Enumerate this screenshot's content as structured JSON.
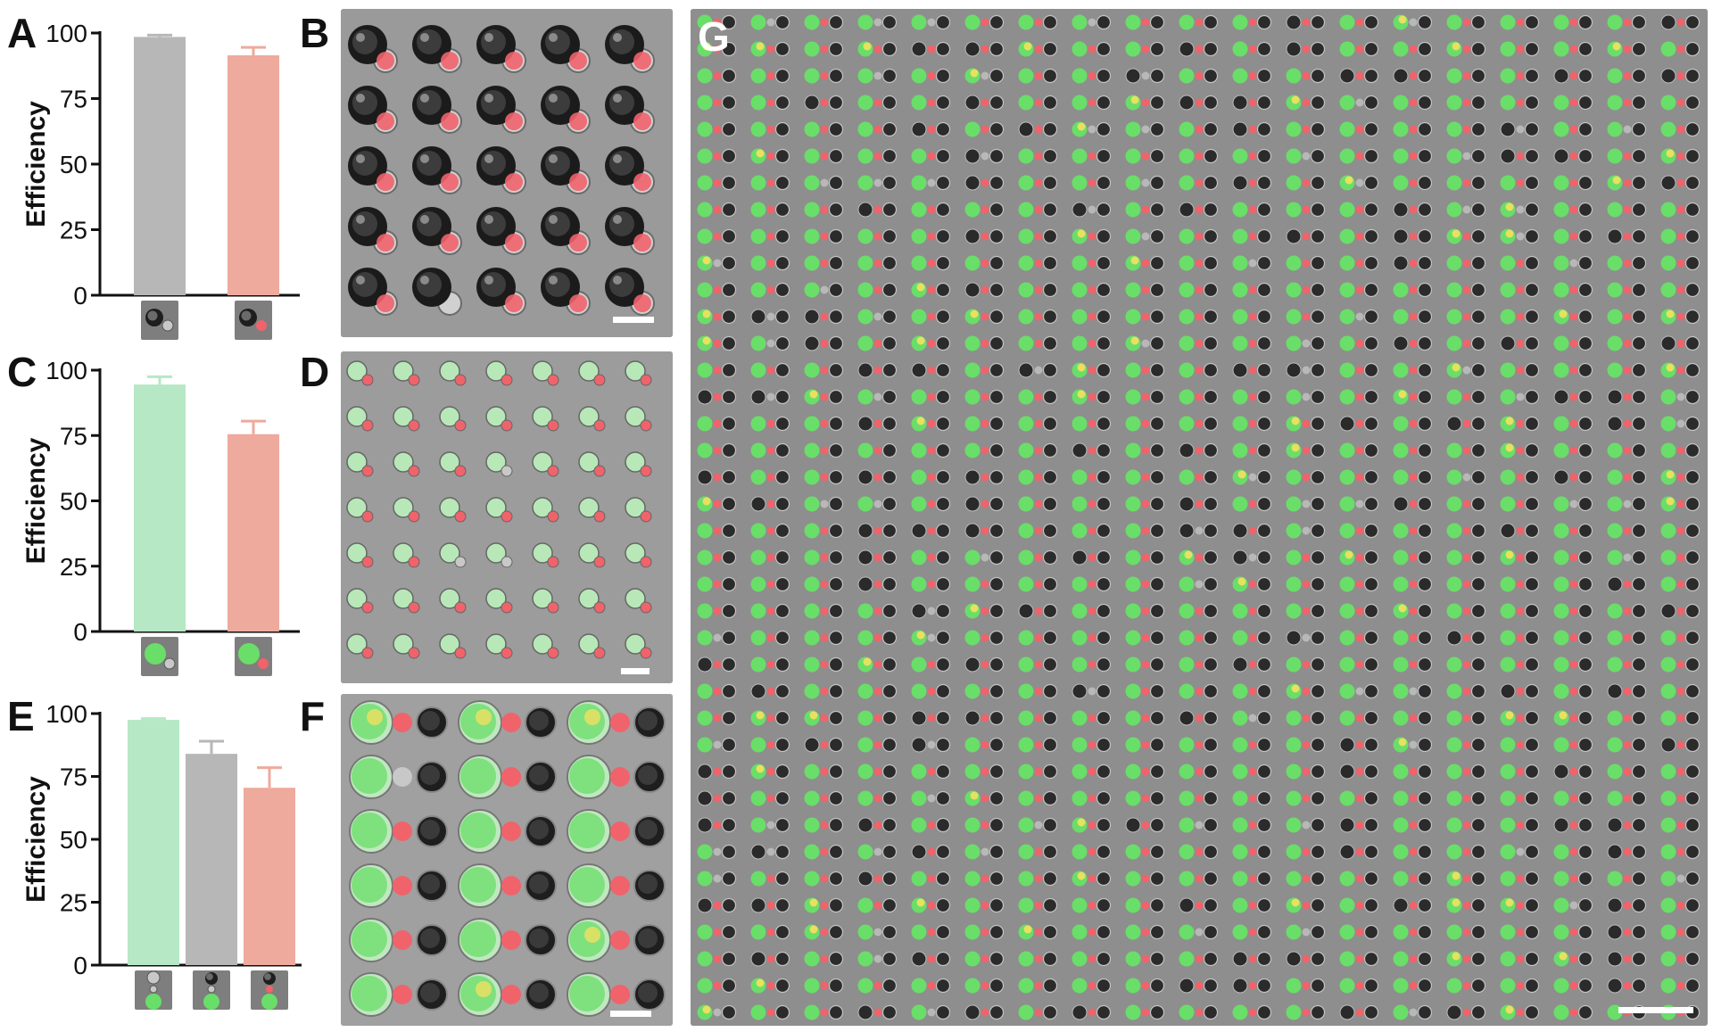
{
  "panels": {
    "a": "A",
    "b": "B",
    "c": "C",
    "d": "D",
    "e": "E",
    "f": "F",
    "g": "G"
  },
  "colors": {
    "gray_bar": "#b7b7b7",
    "red_bar": "#eeaa9c",
    "green_bar": "#b6e8c5",
    "green_drop": "#69de68",
    "red_drop": "#f0636b",
    "yellow_drop": "#e8e060",
    "dark_drop": "#2a2a2a",
    "background_gray": "#8e8e8e"
  },
  "chart_data": [
    {
      "id": "A",
      "type": "bar",
      "categories": [
        "",
        ""
      ],
      "values": [
        98.5,
        91.5
      ],
      "errors": [
        0.7,
        3.0
      ],
      "bar_colors": [
        "#b7b7b7",
        "#eeaa9c"
      ],
      "inset_icons": [
        "dark-gray-pair",
        "dark-red-pair"
      ],
      "ylabel": "Efficiency",
      "yticks": [
        "0",
        "25",
        "50",
        "75",
        "100"
      ],
      "ylim": [
        0,
        100
      ]
    },
    {
      "id": "C",
      "type": "bar",
      "categories": [
        "",
        ""
      ],
      "values": [
        94.5,
        75.5
      ],
      "errors": [
        3.0,
        5.0
      ],
      "bar_colors": [
        "#b6e8c5",
        "#eeaa9c"
      ],
      "inset_icons": [
        "green-gray-pair",
        "green-red-pair"
      ],
      "ylabel": "Efficiency",
      "yticks": [
        "0",
        "25",
        "50",
        "75",
        "100"
      ],
      "ylim": [
        0,
        100
      ]
    },
    {
      "id": "E",
      "type": "bar",
      "categories": [
        "",
        "",
        ""
      ],
      "values": [
        97.5,
        84.0,
        70.5
      ],
      "errors": [
        0.5,
        5.0,
        8.0
      ],
      "bar_colors": [
        "#b6e8c5",
        "#b7b7b7",
        "#eeaa9c"
      ],
      "inset_icons": [
        "green-chain",
        "dark-gray-chain",
        "dark-red-green-chain"
      ],
      "ylabel": "Efficiency",
      "yticks": [
        "0",
        "25",
        "50",
        "75",
        "100"
      ],
      "ylim": [
        0,
        100
      ]
    }
  ]
}
